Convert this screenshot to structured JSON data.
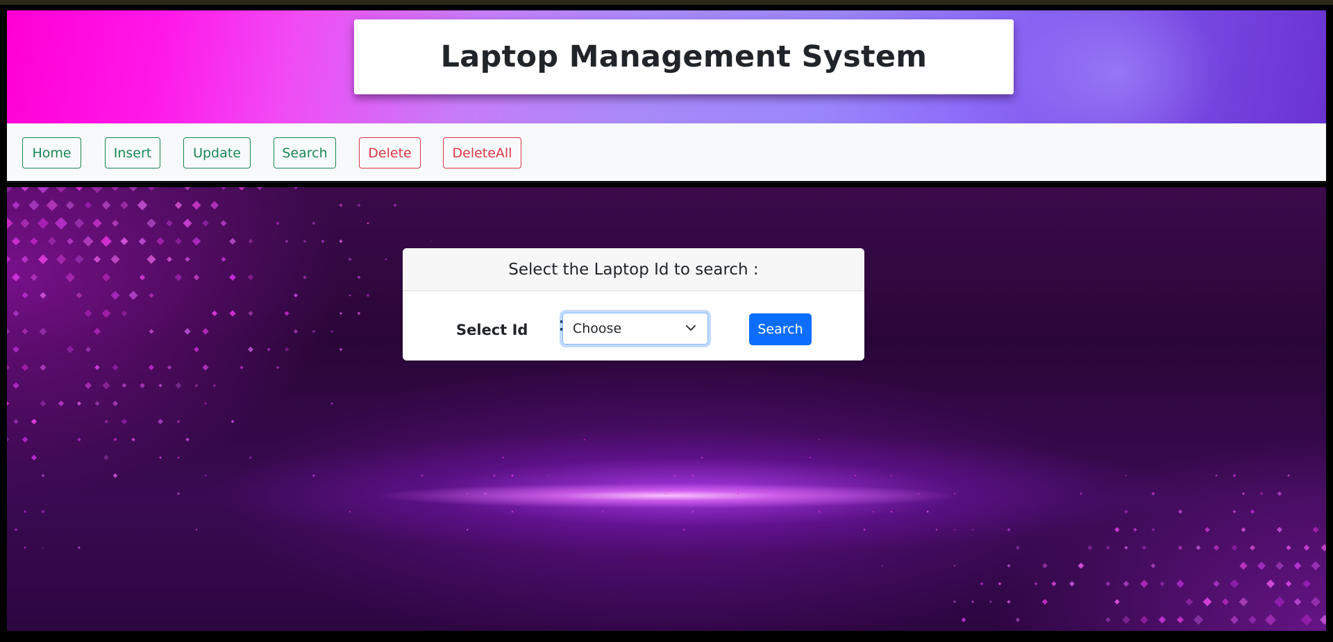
{
  "header": {
    "title": "Laptop Management System"
  },
  "nav": {
    "items": [
      {
        "label": "Home"
      },
      {
        "label": "Insert"
      },
      {
        "label": "Update"
      },
      {
        "label": "Search"
      },
      {
        "label": "Delete"
      },
      {
        "label": "DeleteAll"
      }
    ]
  },
  "search_card": {
    "heading": "Select the Laptop Id to search :",
    "field_label": "Select Id",
    "select_value": "Choose",
    "select_icon": "chevron-down-icon",
    "button_label": "Search"
  },
  "colors": {
    "success": "#198754",
    "danger": "#dc3545",
    "primary": "#0d6efd",
    "header_gradient_start": "#ff00d4",
    "header_gradient_end": "#6a33d2"
  }
}
